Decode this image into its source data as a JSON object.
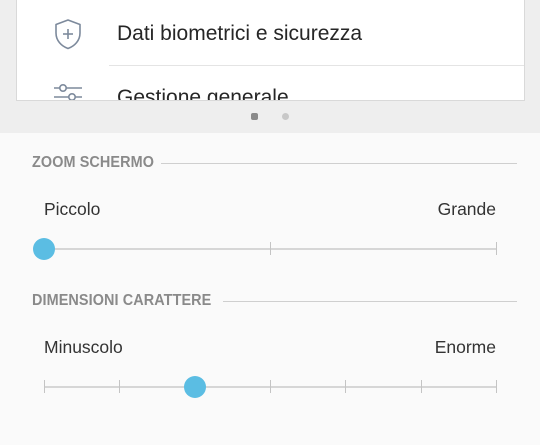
{
  "preview": {
    "items": [
      {
        "label": "Dati biometrici e sicurezza",
        "icon": "shield-plus-icon"
      },
      {
        "label": "Gestione generale",
        "icon": "sliders-icon"
      }
    ],
    "pager": {
      "current_page": 1,
      "page_count": 2
    }
  },
  "zoom": {
    "title": "ZOOM SCHERMO",
    "min_label": "Piccolo",
    "max_label": "Grande",
    "steps": 3,
    "selected_index": 0
  },
  "font_size": {
    "title": "DIMENSIONI CARATTERE",
    "min_label": "Minuscolo",
    "max_label": "Enorme",
    "steps": 7,
    "selected_index": 2
  },
  "colors": {
    "accent": "#5bbde3",
    "section_title": "#8a8a8a",
    "icon": "#7d8a9c"
  }
}
